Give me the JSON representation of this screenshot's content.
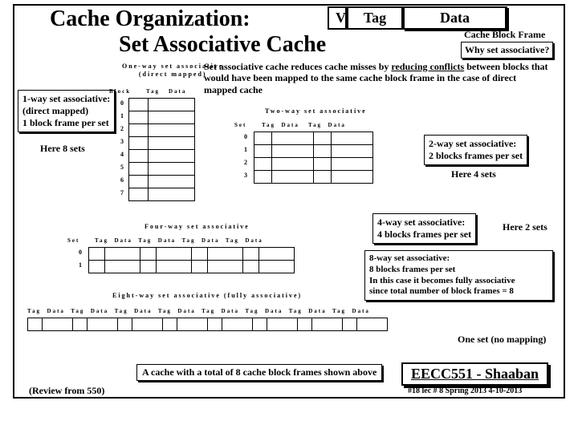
{
  "title": "Cache Organization:",
  "subtitle": "Set Associative Cache",
  "vtd": {
    "v": "V",
    "tag": "Tag",
    "data": "Data"
  },
  "cache_block_frame": "Cache Block Frame",
  "why": "Why set associative?",
  "explain": "Set associative cache reduces cache misses by reducing conflicts between blocks that would have been mapped to the same cache block frame in the case of direct mapped cache",
  "one_way": {
    "label_l1": "One-way set associative",
    "label_l2": "(direct mapped)",
    "block_th": "Block",
    "tag_th": "Tag",
    "data_th": "Data",
    "rows": [
      "0",
      "1",
      "2",
      "3",
      "4",
      "5",
      "6",
      "7"
    ]
  },
  "callout1_l1": "1-way set associative:",
  "callout1_l2": "(direct mapped)",
  "callout1_l3": "1 block frame per set",
  "here8": "Here 8 sets",
  "two_way": {
    "label": "Two-way set associative",
    "th": "Set     Tag  Data   Tag  Data",
    "rows": [
      "0",
      "1",
      "2",
      "3"
    ]
  },
  "callout2_l1": "2-way set associative:",
  "callout2_l2": "2 blocks frames per set",
  "here4": "Here 4 sets",
  "four_way": {
    "label": "Four-way set associative",
    "th": "Set     Tag  Data  Tag  Data  Tag  Data  Tag  Data",
    "rows": [
      "0",
      "1"
    ]
  },
  "callout4_l1": "4-way set associative:",
  "callout4_l2": "4 blocks frames per set",
  "here2": "Here 2 sets",
  "callout8_l1": "8-way set associative:",
  "callout8_l2": "8 blocks frames per set",
  "callout8_l3": "In this case it becomes fully associative",
  "callout8_l4": "since total number of block frames = 8",
  "eight_way": {
    "label": "Eight-way set associative (fully associative)",
    "th": "Tag  Data  Tag  Data  Tag  Data  Tag  Data  Tag  Data  Tag  Data  Tag  Data  Tag  Data"
  },
  "one_set": "One set (no mapping)",
  "summary": "A cache with a total of 8 cache block frames shown above",
  "course": "EECC551 - Shaaban",
  "footer": "#18  lec # 8    Spring 2013  4-10-2013",
  "review": "(Review from 550)"
}
